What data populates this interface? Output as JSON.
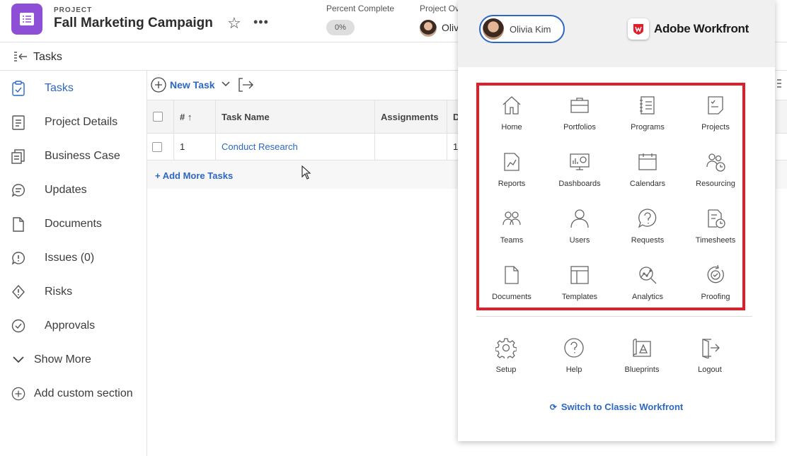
{
  "header": {
    "kicker": "PROJECT",
    "title": "Fall Marketing Campaign",
    "percent_complete_label": "Percent Complete",
    "percent_complete_value": "0%",
    "project_owner_label": "Project Ov",
    "project_owner_name": "Oliv"
  },
  "tasks_bar": {
    "title": "Tasks"
  },
  "left_nav": {
    "items": [
      {
        "label": "Tasks",
        "icon": "tasks-icon"
      },
      {
        "label": "Project Details",
        "icon": "details-icon"
      },
      {
        "label": "Business Case",
        "icon": "business-case-icon"
      },
      {
        "label": "Updates",
        "icon": "updates-icon"
      },
      {
        "label": "Documents",
        "icon": "documents-icon"
      },
      {
        "label": "Issues (0)",
        "icon": "issues-icon"
      },
      {
        "label": "Risks",
        "icon": "risks-icon"
      },
      {
        "label": "Approvals",
        "icon": "approvals-icon"
      },
      {
        "label": "Show More",
        "icon": "chevron-down-icon"
      },
      {
        "label": "Add custom section",
        "icon": "plus-circle-icon"
      }
    ]
  },
  "toolbar": {
    "new_task": "New Task"
  },
  "table": {
    "columns": [
      "#",
      "Task Name",
      "Assignments",
      "D"
    ],
    "rows": [
      {
        "num": "1",
        "name": "Conduct Research",
        "assignments": "",
        "d": "1"
      }
    ],
    "add_more": "+ Add More Tasks"
  },
  "menu_panel": {
    "user_name": "Olivia Kim",
    "brand": "Adobe Workfront",
    "tiles": [
      {
        "label": "Home",
        "icon": "home-icon"
      },
      {
        "label": "Portfolios",
        "icon": "portfolios-icon"
      },
      {
        "label": "Programs",
        "icon": "programs-icon"
      },
      {
        "label": "Projects",
        "icon": "projects-icon"
      },
      {
        "label": "Reports",
        "icon": "reports-icon"
      },
      {
        "label": "Dashboards",
        "icon": "dashboards-icon"
      },
      {
        "label": "Calendars",
        "icon": "calendars-icon"
      },
      {
        "label": "Resourcing",
        "icon": "resourcing-icon"
      },
      {
        "label": "Teams",
        "icon": "teams-icon"
      },
      {
        "label": "Users",
        "icon": "users-icon"
      },
      {
        "label": "Requests",
        "icon": "requests-icon"
      },
      {
        "label": "Timesheets",
        "icon": "timesheets-icon"
      },
      {
        "label": "Documents",
        "icon": "documents-icon"
      },
      {
        "label": "Templates",
        "icon": "templates-icon"
      },
      {
        "label": "Analytics",
        "icon": "analytics-icon"
      },
      {
        "label": "Proofing",
        "icon": "proofing-icon"
      }
    ],
    "bottom_tiles": [
      {
        "label": "Setup",
        "icon": "gear-icon"
      },
      {
        "label": "Help",
        "icon": "help-icon"
      },
      {
        "label": "Blueprints",
        "icon": "blueprints-icon"
      },
      {
        "label": "Logout",
        "icon": "logout-icon"
      }
    ],
    "switch_label": "Switch to Classic Workfront"
  },
  "colors": {
    "accent": "#2c67c4",
    "highlight_box": "#e01e2a",
    "project_icon": "#8d4fd6"
  }
}
